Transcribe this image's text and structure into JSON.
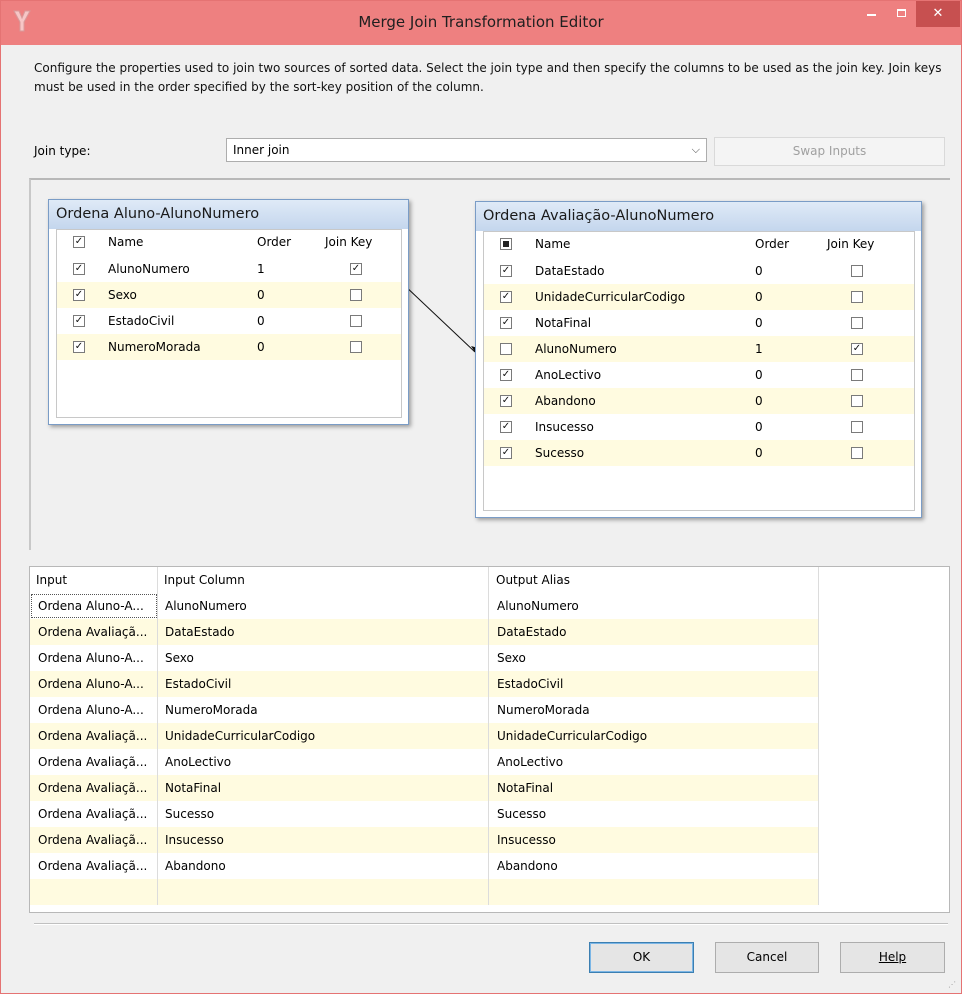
{
  "window": {
    "title": "Merge Join Transformation Editor"
  },
  "description": "Configure the properties used to join two sources of sorted data. Select the join type and then specify the columns to be used as the join key. Join keys must be used in the order specified by the sort-key position of the column.",
  "join_type": {
    "label": "Join type:",
    "value": "Inner join"
  },
  "swap_inputs_label": "Swap Inputs",
  "left_source": {
    "title": "Ordena Aluno-AlunoNumero",
    "headers": {
      "name": "Name",
      "order": "Order",
      "join_key": "Join Key"
    },
    "select_all_checked": true,
    "rows": [
      {
        "name": "AlunoNumero",
        "order": "1",
        "selected": true,
        "join_key": true
      },
      {
        "name": "Sexo",
        "order": "0",
        "selected": true,
        "join_key": false
      },
      {
        "name": "EstadoCivil",
        "order": "0",
        "selected": true,
        "join_key": false
      },
      {
        "name": "NumeroMorada",
        "order": "0",
        "selected": true,
        "join_key": false
      }
    ]
  },
  "right_source": {
    "title": "Ordena Avaliação-AlunoNumero",
    "headers": {
      "name": "Name",
      "order": "Order",
      "join_key": "Join Key"
    },
    "select_all_checked": "indeterminate",
    "rows": [
      {
        "name": "DataEstado",
        "order": "0",
        "selected": true,
        "join_key": false
      },
      {
        "name": "UnidadeCurricularCodigo",
        "order": "0",
        "selected": true,
        "join_key": false
      },
      {
        "name": "NotaFinal",
        "order": "0",
        "selected": true,
        "join_key": false
      },
      {
        "name": "AlunoNumero",
        "order": "1",
        "selected": false,
        "join_key": true
      },
      {
        "name": "AnoLectivo",
        "order": "0",
        "selected": true,
        "join_key": false
      },
      {
        "name": "Abandono",
        "order": "0",
        "selected": true,
        "join_key": false
      },
      {
        "name": "Insucesso",
        "order": "0",
        "selected": true,
        "join_key": false
      },
      {
        "name": "Sucesso",
        "order": "0",
        "selected": true,
        "join_key": false
      }
    ]
  },
  "mapping": {
    "headers": {
      "input": "Input",
      "input_column": "Input Column",
      "output_alias": "Output Alias"
    },
    "rows": [
      {
        "input": "Ordena Aluno-A...",
        "input_column": "AlunoNumero",
        "output_alias": "AlunoNumero"
      },
      {
        "input": "Ordena Avaliaçã...",
        "input_column": "DataEstado",
        "output_alias": "DataEstado"
      },
      {
        "input": "Ordena Aluno-A...",
        "input_column": "Sexo",
        "output_alias": "Sexo"
      },
      {
        "input": "Ordena Aluno-A...",
        "input_column": "EstadoCivil",
        "output_alias": "EstadoCivil"
      },
      {
        "input": "Ordena Aluno-A...",
        "input_column": "NumeroMorada",
        "output_alias": "NumeroMorada"
      },
      {
        "input": "Ordena Avaliaçã...",
        "input_column": "UnidadeCurricularCodigo",
        "output_alias": "UnidadeCurricularCodigo"
      },
      {
        "input": "Ordena Avaliaçã...",
        "input_column": "AnoLectivo",
        "output_alias": "AnoLectivo"
      },
      {
        "input": "Ordena Avaliaçã...",
        "input_column": "NotaFinal",
        "output_alias": "NotaFinal"
      },
      {
        "input": "Ordena Avaliaçã...",
        "input_column": "Sucesso",
        "output_alias": "Sucesso"
      },
      {
        "input": "Ordena Avaliaçã...",
        "input_column": "Insucesso",
        "output_alias": "Insucesso"
      },
      {
        "input": "Ordena Avaliaçã...",
        "input_column": "Abandono",
        "output_alias": "Abandono"
      },
      {
        "input": "",
        "input_column": "",
        "output_alias": ""
      }
    ]
  },
  "buttons": {
    "ok": "OK",
    "cancel": "Cancel",
    "help": "Help"
  },
  "colors": {
    "titlebar": "#ee8080",
    "alt_row": "#fffbe0",
    "source_header": "#c4d6ed"
  }
}
